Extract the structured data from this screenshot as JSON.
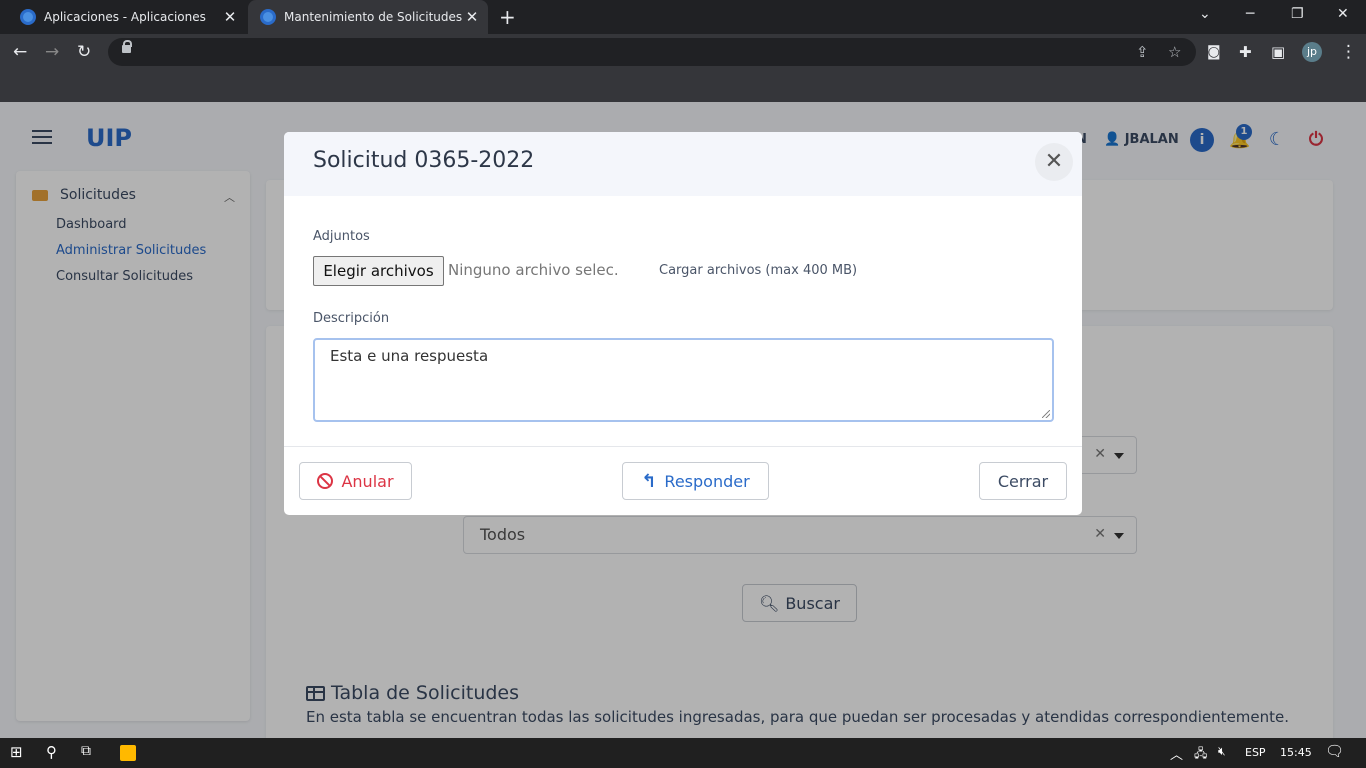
{
  "browser": {
    "tabs": [
      {
        "title": "Aplicaciones - Aplicaciones",
        "active": false
      },
      {
        "title": "Mantenimiento de Solicitudes - I",
        "active": true
      }
    ],
    "new_tab_label": "+",
    "profile_initials": "jp"
  },
  "app": {
    "logo": "UIP",
    "header": {
      "user_prefix": "N",
      "user": "JBALAN",
      "notification_count": "1"
    },
    "sidebar": {
      "group_label": "Solicitudes",
      "items": [
        "Dashboard",
        "Administrar Solicitudes",
        "Consultar Solicitudes"
      ]
    },
    "filters": {
      "select1_value": "",
      "select2_value": "Todos",
      "search_label": "Buscar"
    },
    "table_card": {
      "title": "Tabla de Solicitudes",
      "description": "En esta tabla se encuentran todas las solicitudes ingresadas, para que puedan ser procesadas y atendidas correspondientemente."
    }
  },
  "modal": {
    "title": "Solicitud 0365-2022",
    "attachments_label": "Adjuntos",
    "file_button": "Elegir archivos",
    "file_status": "Ninguno archivo selec.",
    "upload_hint": "Cargar archivos (max 400 MB)",
    "description_label": "Descripción",
    "description_value": "Esta e una respuesta",
    "buttons": {
      "annul": "Anular",
      "reply": "Responder",
      "close": "Cerrar"
    }
  },
  "taskbar": {
    "language": "ESP",
    "time": "15:45"
  },
  "colors": {
    "primary": "#2a6bc9",
    "danger": "#dc3545",
    "text": "#3c4b64"
  }
}
